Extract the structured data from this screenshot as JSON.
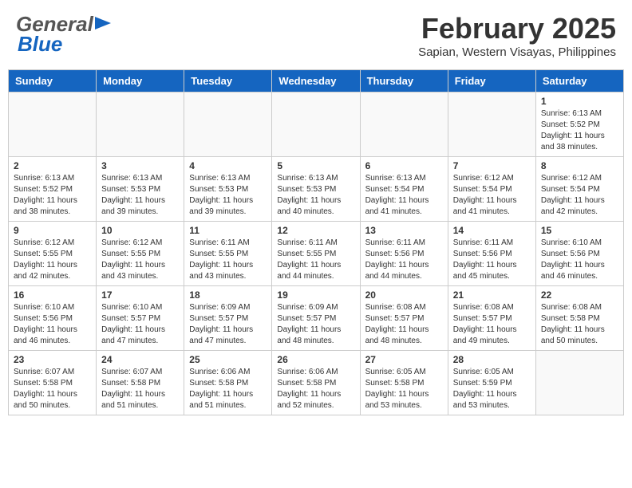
{
  "header": {
    "logo_general": "General",
    "logo_blue": "Blue",
    "month_title": "February 2025",
    "subtitle": "Sapian, Western Visayas, Philippines"
  },
  "weekdays": [
    "Sunday",
    "Monday",
    "Tuesday",
    "Wednesday",
    "Thursday",
    "Friday",
    "Saturday"
  ],
  "weeks": [
    [
      {
        "day": "",
        "info": ""
      },
      {
        "day": "",
        "info": ""
      },
      {
        "day": "",
        "info": ""
      },
      {
        "day": "",
        "info": ""
      },
      {
        "day": "",
        "info": ""
      },
      {
        "day": "",
        "info": ""
      },
      {
        "day": "1",
        "info": "Sunrise: 6:13 AM\nSunset: 5:52 PM\nDaylight: 11 hours\nand 38 minutes."
      }
    ],
    [
      {
        "day": "2",
        "info": "Sunrise: 6:13 AM\nSunset: 5:52 PM\nDaylight: 11 hours\nand 38 minutes."
      },
      {
        "day": "3",
        "info": "Sunrise: 6:13 AM\nSunset: 5:53 PM\nDaylight: 11 hours\nand 39 minutes."
      },
      {
        "day": "4",
        "info": "Sunrise: 6:13 AM\nSunset: 5:53 PM\nDaylight: 11 hours\nand 39 minutes."
      },
      {
        "day": "5",
        "info": "Sunrise: 6:13 AM\nSunset: 5:53 PM\nDaylight: 11 hours\nand 40 minutes."
      },
      {
        "day": "6",
        "info": "Sunrise: 6:13 AM\nSunset: 5:54 PM\nDaylight: 11 hours\nand 41 minutes."
      },
      {
        "day": "7",
        "info": "Sunrise: 6:12 AM\nSunset: 5:54 PM\nDaylight: 11 hours\nand 41 minutes."
      },
      {
        "day": "8",
        "info": "Sunrise: 6:12 AM\nSunset: 5:54 PM\nDaylight: 11 hours\nand 42 minutes."
      }
    ],
    [
      {
        "day": "9",
        "info": "Sunrise: 6:12 AM\nSunset: 5:55 PM\nDaylight: 11 hours\nand 42 minutes."
      },
      {
        "day": "10",
        "info": "Sunrise: 6:12 AM\nSunset: 5:55 PM\nDaylight: 11 hours\nand 43 minutes."
      },
      {
        "day": "11",
        "info": "Sunrise: 6:11 AM\nSunset: 5:55 PM\nDaylight: 11 hours\nand 43 minutes."
      },
      {
        "day": "12",
        "info": "Sunrise: 6:11 AM\nSunset: 5:55 PM\nDaylight: 11 hours\nand 44 minutes."
      },
      {
        "day": "13",
        "info": "Sunrise: 6:11 AM\nSunset: 5:56 PM\nDaylight: 11 hours\nand 44 minutes."
      },
      {
        "day": "14",
        "info": "Sunrise: 6:11 AM\nSunset: 5:56 PM\nDaylight: 11 hours\nand 45 minutes."
      },
      {
        "day": "15",
        "info": "Sunrise: 6:10 AM\nSunset: 5:56 PM\nDaylight: 11 hours\nand 46 minutes."
      }
    ],
    [
      {
        "day": "16",
        "info": "Sunrise: 6:10 AM\nSunset: 5:56 PM\nDaylight: 11 hours\nand 46 minutes."
      },
      {
        "day": "17",
        "info": "Sunrise: 6:10 AM\nSunset: 5:57 PM\nDaylight: 11 hours\nand 47 minutes."
      },
      {
        "day": "18",
        "info": "Sunrise: 6:09 AM\nSunset: 5:57 PM\nDaylight: 11 hours\nand 47 minutes."
      },
      {
        "day": "19",
        "info": "Sunrise: 6:09 AM\nSunset: 5:57 PM\nDaylight: 11 hours\nand 48 minutes."
      },
      {
        "day": "20",
        "info": "Sunrise: 6:08 AM\nSunset: 5:57 PM\nDaylight: 11 hours\nand 48 minutes."
      },
      {
        "day": "21",
        "info": "Sunrise: 6:08 AM\nSunset: 5:57 PM\nDaylight: 11 hours\nand 49 minutes."
      },
      {
        "day": "22",
        "info": "Sunrise: 6:08 AM\nSunset: 5:58 PM\nDaylight: 11 hours\nand 50 minutes."
      }
    ],
    [
      {
        "day": "23",
        "info": "Sunrise: 6:07 AM\nSunset: 5:58 PM\nDaylight: 11 hours\nand 50 minutes."
      },
      {
        "day": "24",
        "info": "Sunrise: 6:07 AM\nSunset: 5:58 PM\nDaylight: 11 hours\nand 51 minutes."
      },
      {
        "day": "25",
        "info": "Sunrise: 6:06 AM\nSunset: 5:58 PM\nDaylight: 11 hours\nand 51 minutes."
      },
      {
        "day": "26",
        "info": "Sunrise: 6:06 AM\nSunset: 5:58 PM\nDaylight: 11 hours\nand 52 minutes."
      },
      {
        "day": "27",
        "info": "Sunrise: 6:05 AM\nSunset: 5:58 PM\nDaylight: 11 hours\nand 53 minutes."
      },
      {
        "day": "28",
        "info": "Sunrise: 6:05 AM\nSunset: 5:59 PM\nDaylight: 11 hours\nand 53 minutes."
      },
      {
        "day": "",
        "info": ""
      }
    ]
  ]
}
